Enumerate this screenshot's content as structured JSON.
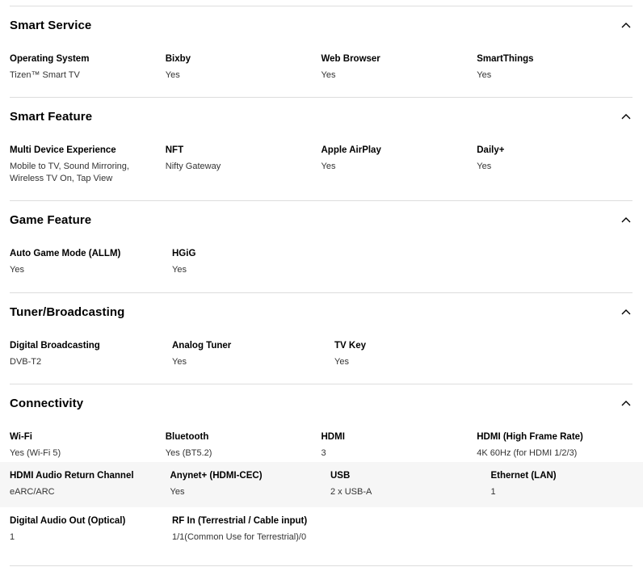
{
  "sections": [
    {
      "title": "Smart Service",
      "rows": [
        [
          {
            "label": "Operating System",
            "value": "Tizen™ Smart TV"
          },
          {
            "label": "Bixby",
            "value": "Yes"
          },
          {
            "label": "Web Browser",
            "value": "Yes"
          },
          {
            "label": "SmartThings",
            "value": "Yes"
          }
        ]
      ]
    },
    {
      "title": "Smart Feature",
      "rows": [
        [
          {
            "label": "Multi Device Experience",
            "value": "Mobile to TV, Sound Mirroring,",
            "value2": "Wireless TV On, Tap View"
          },
          {
            "label": "NFT",
            "value": "Nifty Gateway"
          },
          {
            "label": "Apple AirPlay",
            "value": "Yes"
          },
          {
            "label": "Daily+",
            "value": "Yes"
          }
        ]
      ]
    },
    {
      "title": "Game Feature",
      "rows": [
        [
          {
            "label": "Auto Game Mode (ALLM)",
            "value": "Yes"
          },
          {
            "label": "HGiG",
            "value": "Yes"
          }
        ]
      ]
    },
    {
      "title": "Tuner/Broadcasting",
      "rows": [
        [
          {
            "label": "Digital Broadcasting",
            "value": "DVB-T2"
          },
          {
            "label": "Analog Tuner",
            "value": "Yes"
          },
          {
            "label": "TV Key",
            "value": "Yes"
          }
        ]
      ]
    },
    {
      "title": "Connectivity",
      "rows": [
        [
          {
            "label": "Wi-Fi",
            "value": "Yes (Wi-Fi 5)"
          },
          {
            "label": "Bluetooth",
            "value": "Yes (BT5.2)"
          },
          {
            "label": "HDMI",
            "value": "3"
          },
          {
            "label": "HDMI (High Frame Rate)",
            "value": "4K 60Hz (for HDMI 1/2/3)"
          }
        ],
        [
          {
            "label": "HDMI Audio Return Channel",
            "value": "eARC/ARC"
          },
          {
            "label": "Anynet+ (HDMI-CEC)",
            "value": "Yes"
          },
          {
            "label": "USB",
            "value": "2 x USB-A"
          },
          {
            "label": "Ethernet (LAN)",
            "value": "1"
          }
        ],
        [
          {
            "label": "Digital Audio Out (Optical)",
            "value": "1"
          },
          {
            "label": "RF In (Terrestrial / Cable input)",
            "value": "1/1(Common Use for Terrestrial)/0"
          }
        ]
      ]
    }
  ],
  "icons": {
    "collapse": "chevron-up-icon"
  },
  "colors": {
    "divider": "#dddddd",
    "shaded_row": "#f6f6f6"
  }
}
